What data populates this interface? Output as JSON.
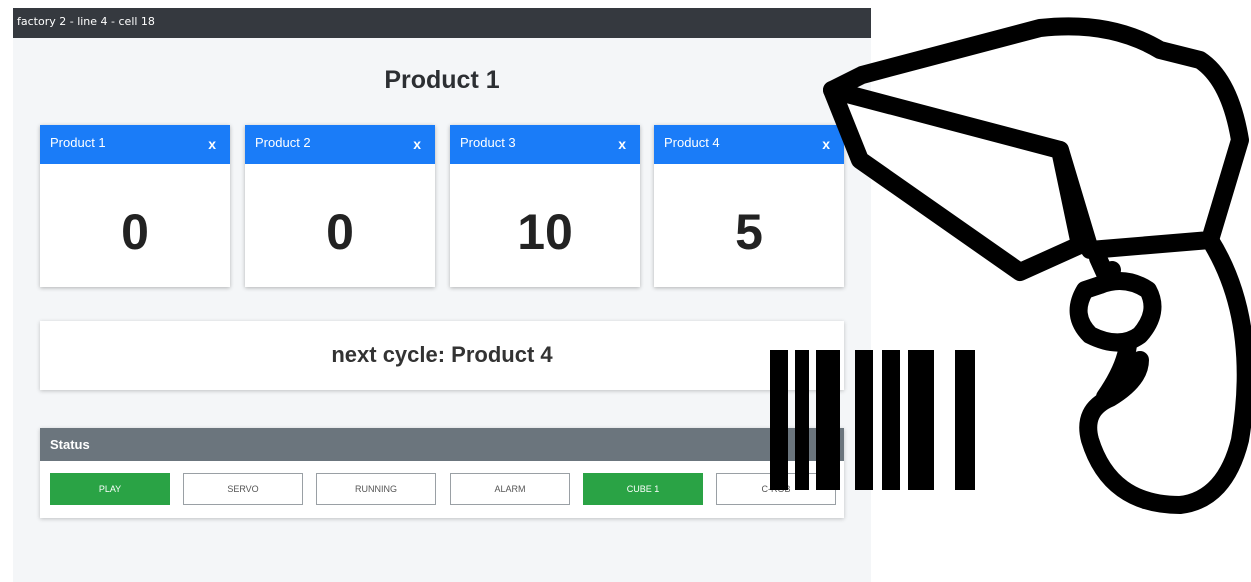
{
  "window": {
    "title": "factory 2 - line 4 - cell 18"
  },
  "header": {
    "title": "Product 1"
  },
  "products": [
    {
      "label": "Product 1",
      "count": "0",
      "close": "x"
    },
    {
      "label": "Product 2",
      "count": "0",
      "close": "x"
    },
    {
      "label": "Product 3",
      "count": "10",
      "close": "x"
    },
    {
      "label": "Product 4",
      "count": "5",
      "close": "x"
    }
  ],
  "next_cycle": {
    "text": "next cycle: Product 4"
  },
  "status": {
    "title": "Status",
    "buttons": [
      {
        "label": "PLAY",
        "active": true
      },
      {
        "label": "SERVO",
        "active": false
      },
      {
        "label": "RUNNING",
        "active": false
      },
      {
        "label": "ALARM",
        "active": false
      },
      {
        "label": "CUBE 1",
        "active": true
      },
      {
        "label": "C-ROB",
        "active": false
      }
    ]
  },
  "colors": {
    "card_header": "#1a7cf8",
    "status_header": "#6b757d",
    "active_button": "#2aa345",
    "titlebar": "#35393f"
  },
  "icons": {
    "overlay": "barcode-scanner-icon"
  }
}
